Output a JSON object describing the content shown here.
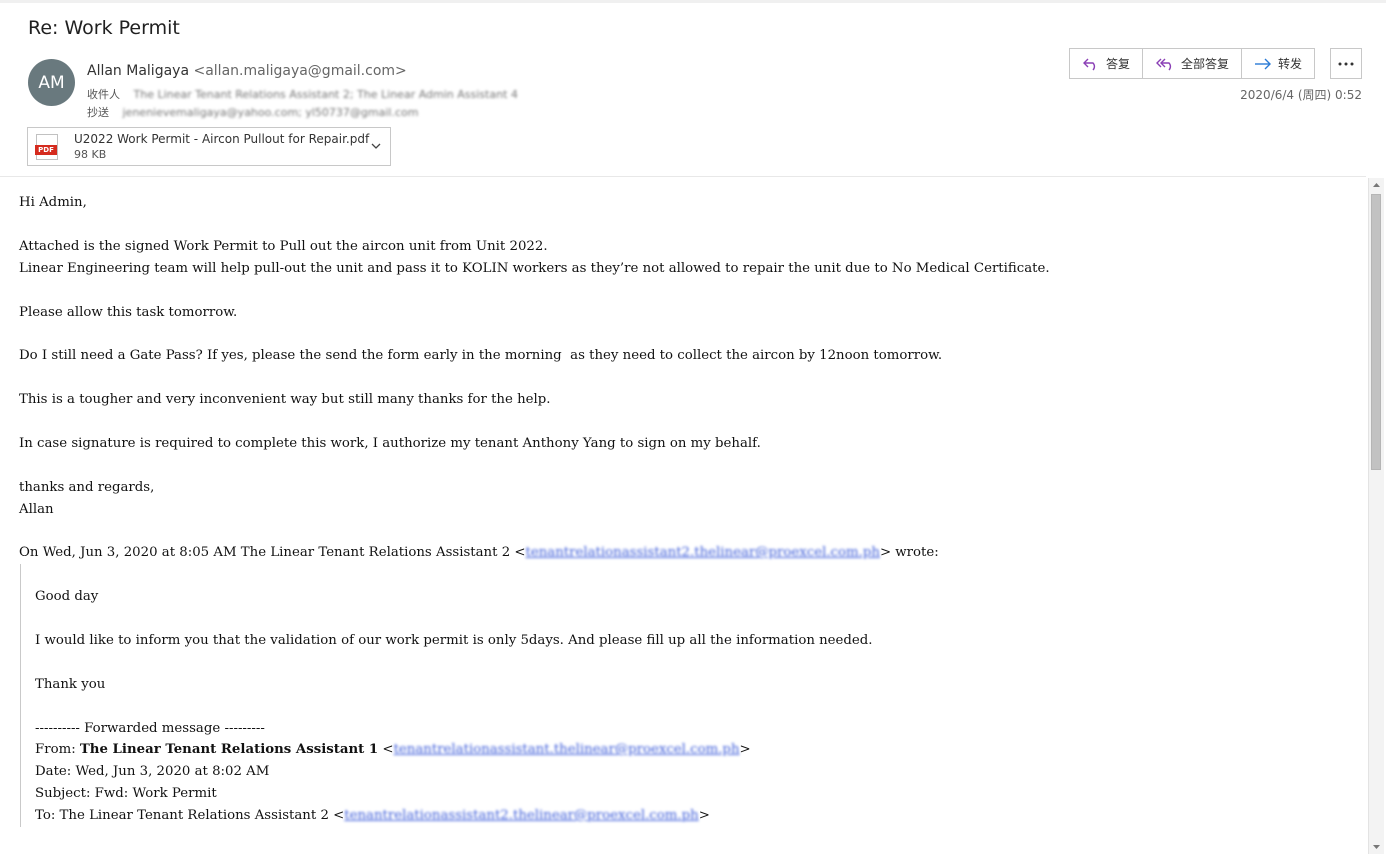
{
  "header": {
    "subject": "Re: Work Permit",
    "avatar_initials": "AM",
    "sender_name": "Allan Maligaya",
    "sender_email": "<allan.maligaya@gmail.com>",
    "to_label": "收件人",
    "to_value": "The Linear Tenant Relations Assistant 2; The Linear Admin Assistant 4",
    "cc_label": "抄送",
    "cc_value": "jenenievemaligaya@yahoo.com; yl50737@gmail.com",
    "date": "2020/6/4 (周四) 0:52"
  },
  "attachment": {
    "name": "U2022 Work Permit - Aircon Pullout for Repair.pdf",
    "size": "98 KB",
    "type_tag": "PDF"
  },
  "actions": {
    "reply": "答复",
    "reply_all": "全部答复",
    "forward": "转发"
  },
  "body": {
    "greeting": "Hi Admin,",
    "p1_l1": "Attached is the signed Work Permit to Pull out the aircon unit from Unit 2022.",
    "p1_l2": "Linear Engineering team will help pull-out the unit and pass it to KOLIN workers as they’re not allowed to repair the unit due to No Medical Certificate.",
    "p2": "Please allow this task tomorrow.",
    "p3": "Do I still need a Gate Pass? If yes, please the send the form early in the morning  as they need to collect the aircon by 12noon tomorrow.",
    "p4": "This is a tougher and very inconvenient way but still many thanks for the help.",
    "p5": "In case signature is required to complete this work, I authorize my tenant Anthony Yang to sign on my behalf.",
    "closing": "thanks and regards,",
    "signature": "Allan",
    "quote_header_pre": "On Wed, Jun 3, 2020 at 8:05 AM The Linear Tenant Relations Assistant 2 <",
    "quote_header_link": "tenantrelationassistant2.thelinear@proexcel.com.ph",
    "quote_header_post": "> wrote:"
  },
  "quote": {
    "greeting": "Good day",
    "text": "I would like to inform you that the validation of our work permit is only 5days. And please fill up all the information needed.",
    "thanks": "Thank you",
    "fwd_sep": "---------- Forwarded message ---------",
    "from_label": "From: ",
    "from_name": "The Linear Tenant Relations Assistant 1",
    "from_link": "tenantrelationassistant.thelinear@proexcel.com.ph",
    "date_line": "Date: Wed, Jun 3, 2020 at 8:02 AM",
    "subject_line": "Subject: Fwd: Work Permit",
    "to_pre": "To: The Linear Tenant Relations Assistant 2 <",
    "to_link": "tenantrelationassistant2.thelinear@proexcel.com.ph",
    "lt": "<",
    "gt": ">"
  }
}
